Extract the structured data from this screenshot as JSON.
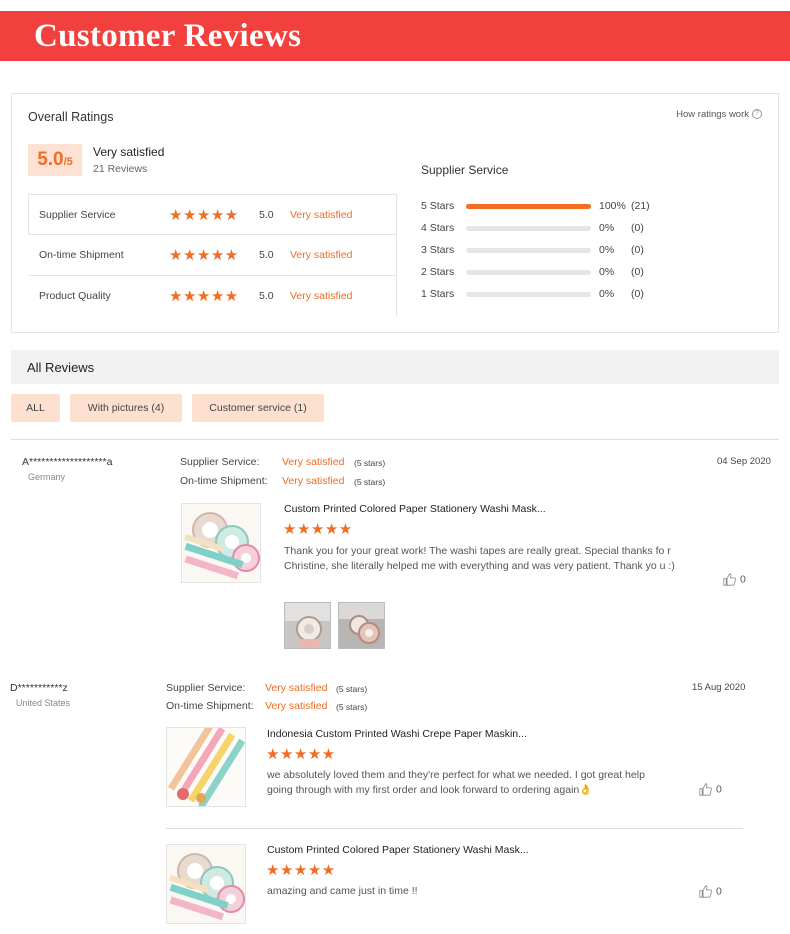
{
  "banner": {
    "title": "Customer Reviews"
  },
  "overall": {
    "title": "Overall Ratings",
    "how_link": "How ratings work",
    "score": "5.0",
    "score_suffix": "/5",
    "satisfaction": "Very satisfied",
    "review_count": "21 Reviews",
    "categories": [
      {
        "label": "Supplier Service",
        "stars": "★★★★★",
        "score": "5.0",
        "desc": "Very satisfied"
      },
      {
        "label": "On-time Shipment",
        "stars": "★★★★★",
        "score": "5.0",
        "desc": "Very satisfied"
      },
      {
        "label": "Product Quality",
        "stars": "★★★★★",
        "score": "5.0",
        "desc": "Very satisfied"
      }
    ]
  },
  "supplier_service": {
    "title": "Supplier Service",
    "rows": [
      {
        "label": "5  Stars",
        "fraction": 1.0,
        "pct": "100%",
        "count": "(21)"
      },
      {
        "label": "4  Stars",
        "fraction": 0,
        "pct": "0%",
        "count": "(0)"
      },
      {
        "label": "3  Stars",
        "fraction": 0,
        "pct": "0%",
        "count": "(0)"
      },
      {
        "label": "2  Stars",
        "fraction": 0,
        "pct": "0%",
        "count": "(0)"
      },
      {
        "label": "1  Stars",
        "fraction": 0,
        "pct": "0%",
        "count": "(0)"
      }
    ]
  },
  "all_reviews": {
    "title": "All Reviews",
    "filters": [
      "ALL",
      "With pictures (4)",
      "Customer service (1)"
    ]
  },
  "reviews": [
    {
      "name": "A*******************a",
      "country": "Germany",
      "date": "04 Sep 2020",
      "supplier_label": "Supplier Service:",
      "supplier_val": "Very satisfied",
      "supplier_stars": "(5 stars)",
      "shipment_label": "On-time Shipment:",
      "shipment_val": "Very satisfied",
      "shipment_stars": "(5 stars)",
      "products": [
        {
          "title": "Custom Printed Colored Paper Stationery Washi Mask...",
          "stars": "★★★★★",
          "text": "Thank you for your great  work! The washi tapes are really great. Special thanks fo r Christine, she literally helped me with everything and was very patient. Thank yo u :)",
          "likes": "0"
        }
      ]
    },
    {
      "name": "D***********z",
      "country": "United States",
      "date": "15 Aug 2020",
      "supplier_label": "Supplier Service:",
      "supplier_val": "Very satisfied",
      "supplier_stars": "(5 stars)",
      "shipment_label": "On-time Shipment:",
      "shipment_val": "Very satisfied",
      "shipment_stars": "(5 stars)",
      "products": [
        {
          "title": "Indonesia Custom Printed Washi Crepe Paper Maskin...",
          "stars": "★★★★★",
          "text": "we absolutely loved them and they're perfect for what we needed. I got great help going through with my first order and look forward to ordering again👌",
          "likes": "0"
        },
        {
          "title": "Custom Printed Colored Paper Stationery Washi Mask...",
          "stars": "★★★★★",
          "text": "amazing and came just in time !!",
          "likes": "0"
        }
      ]
    }
  ]
}
